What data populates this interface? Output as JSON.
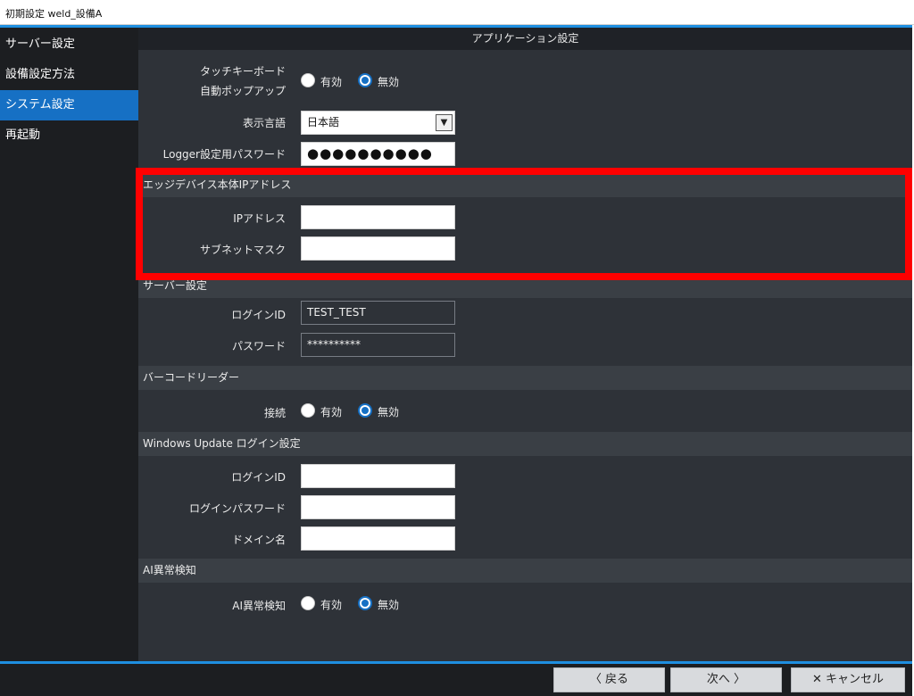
{
  "window": {
    "title": "初期設定 weld_設備A"
  },
  "sidebar": {
    "items": [
      {
        "label": "サーバー設定",
        "active": false
      },
      {
        "label": "設備設定方法",
        "active": false
      },
      {
        "label": "システム設定",
        "active": true
      },
      {
        "label": "再起動",
        "active": false
      }
    ]
  },
  "main": {
    "header": "アプリケーション設定",
    "touch_keyboard": {
      "label_line1": "タッチキーボード",
      "label_line2": "自動ポップアップ",
      "options": [
        "有効",
        "無効"
      ],
      "selected": "無効"
    },
    "display_language": {
      "label": "表示言語",
      "value": "日本語"
    },
    "logger_password": {
      "label": "Logger設定用パスワード",
      "value": "●●●●●●●●●●"
    },
    "edge_ip": {
      "section": "エッジデバイス本体IPアドレス",
      "ip_label": "IPアドレス",
      "ip_value": "",
      "subnet_label": "サブネットマスク",
      "subnet_value": ""
    },
    "server": {
      "section": "サーバー設定",
      "login_id_label": "ログインID",
      "login_id_value": "TEST_TEST",
      "password_label": "パスワード",
      "password_value": "**********"
    },
    "barcode": {
      "section": "バーコードリーダー",
      "label": "接続",
      "options": [
        "有効",
        "無効"
      ],
      "selected": "無効"
    },
    "windows_update": {
      "section": "Windows Update ログイン設定",
      "login_id_label": "ログインID",
      "login_id_value": "",
      "password_label": "ログインパスワード",
      "password_value": "",
      "domain_label": "ドメイン名",
      "domain_value": ""
    },
    "ai": {
      "section": "AI異常検知",
      "label": "AI異常検知",
      "options": [
        "有効",
        "無効"
      ],
      "selected": "無効"
    }
  },
  "footer": {
    "back_label": "〈 戻る",
    "next_label": "次へ 〉",
    "cancel_label": "✕ キャンセル"
  },
  "colors": {
    "accent": "#1670c4",
    "highlight": "#ff0000",
    "panel": "#2e3238"
  }
}
